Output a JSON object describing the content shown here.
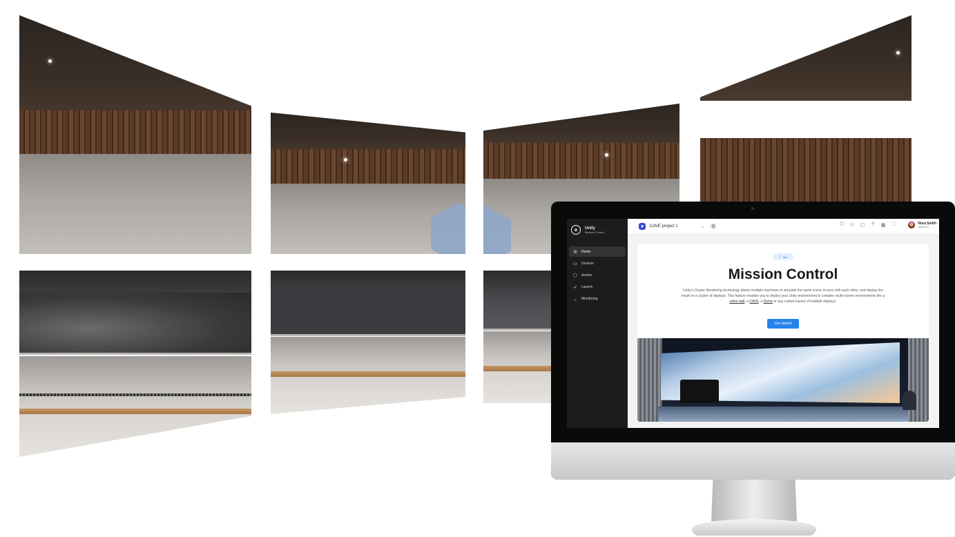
{
  "app": {
    "brand_title": "Unity",
    "brand_subtitle": "Mission Control"
  },
  "sidebar": {
    "items": [
      {
        "label": "Home",
        "icon": "globe-icon",
        "active": true
      },
      {
        "label": "Devices",
        "icon": "devices-icon",
        "active": false
      },
      {
        "label": "Assets",
        "icon": "cube-icon",
        "active": false
      },
      {
        "label": "Launch",
        "icon": "rocket-icon",
        "active": false
      },
      {
        "label": "Monitoring",
        "icon": "chart-icon",
        "active": false
      }
    ]
  },
  "topbar": {
    "project_name": "CAVE project 1",
    "icons": [
      "shield-icon",
      "users-icon",
      "chat-icon",
      "help-icon",
      "grid-icon",
      "fullscreen-icon"
    ],
    "user_name": "Nora Smith",
    "user_org": "VpnetCo"
  },
  "main": {
    "info_label": "Info",
    "title": "Mission Control",
    "description_1": "Unity's Cluster Rendering technology allows multiple machines to simulate the same scene in-sync with each other, and display the result on a cluster of displays. This feature enables you to deploy your Unity environment to complex multi-screen environments like a ",
    "link_video_wall": "video wall",
    "description_2": ", a ",
    "link_cave": "CAVE",
    "description_3": ", a ",
    "link_dome": "Dome",
    "description_4": " or any custom layout of multiple displays.",
    "cta_label": "Get started"
  },
  "colors": {
    "accent": "#2583ec",
    "sidebar_bg": "#1c1c1e",
    "project_icon": "#3b4bd4"
  }
}
